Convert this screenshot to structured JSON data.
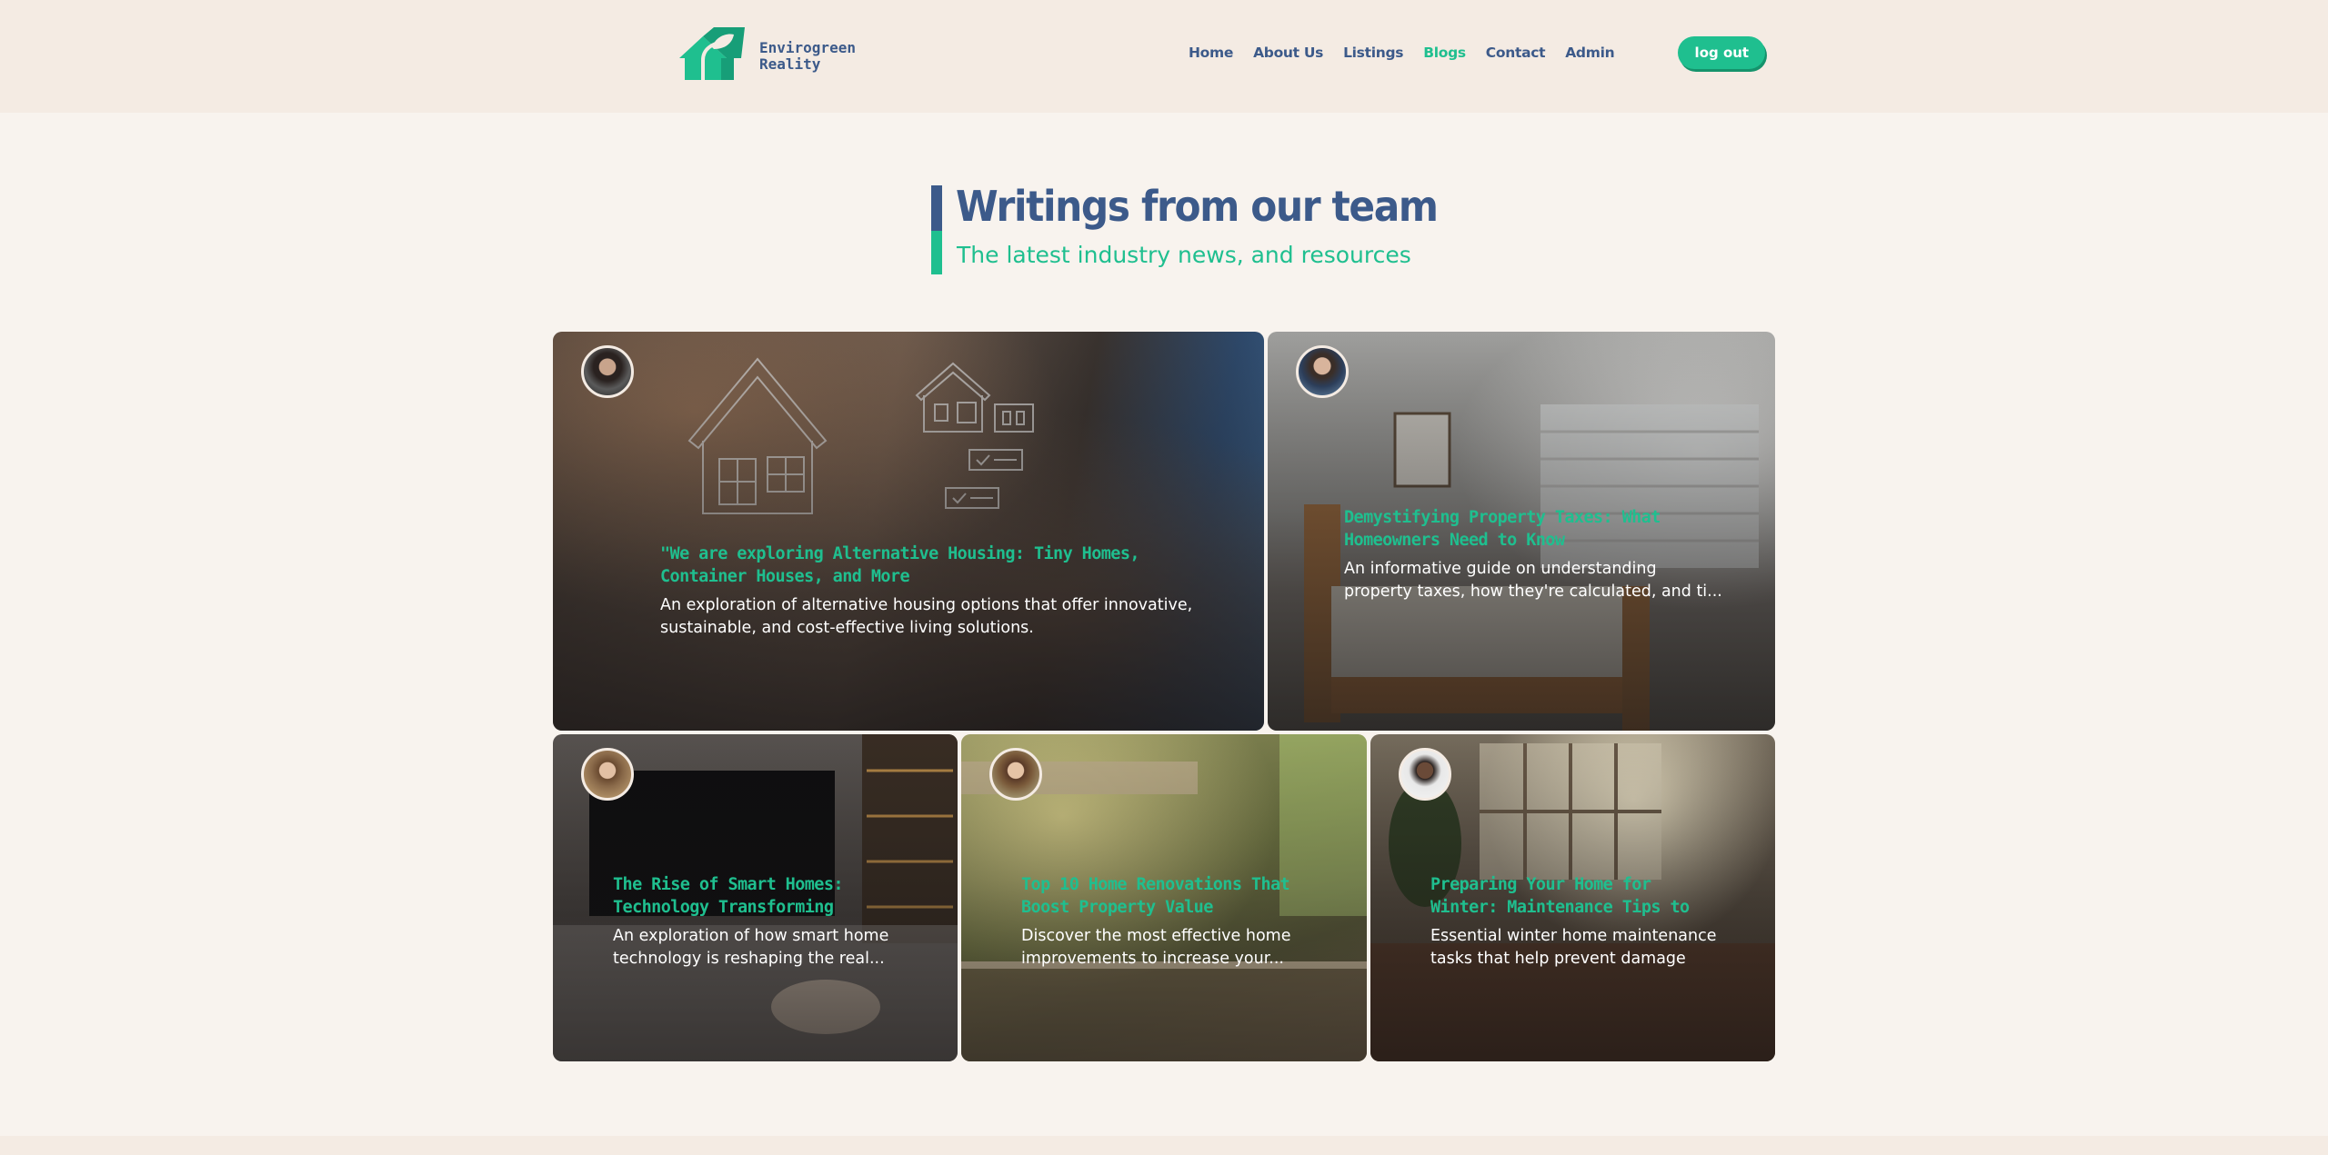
{
  "brand": {
    "name_line1": "Envirogreen",
    "name_line2": "Reality"
  },
  "nav": {
    "items": [
      {
        "label": "Home",
        "active": false
      },
      {
        "label": "About Us",
        "active": false
      },
      {
        "label": "Listings",
        "active": false
      },
      {
        "label": "Blogs",
        "active": true
      },
      {
        "label": "Contact",
        "active": false
      },
      {
        "label": "Admin",
        "active": false
      }
    ],
    "logout_label": "log out"
  },
  "section": {
    "title": "Writings from our team",
    "subtitle": "The latest industry news, and resources"
  },
  "posts": [
    {
      "title": "\"We are exploring Alternative Housing: Tiny Homes, Container Houses, and More",
      "description": "An exploration of alternative housing options that offer innovative, sustainable, and cost-effective living solutions."
    },
    {
      "title": "Demystifying Property Taxes: What Homeowners Need to Know",
      "description": "An informative guide on understanding property taxes, how they're calculated, and ti..."
    },
    {
      "title": "The Rise of Smart Homes: Technology Transforming Real...",
      "description": "An exploration of how smart home technology is reshaping the real..."
    },
    {
      "title": "Top 10 Home Renovations That Boost Property Value",
      "description": "Discover the most effective home improvements to increase your..."
    },
    {
      "title": "Preparing Your Home for Winter: Maintenance Tips to Protect Yo...",
      "description": "Essential winter home maintenance tasks that help prevent damage and..."
    }
  ],
  "colors": {
    "brand_blue": "#3c5a8a",
    "brand_green": "#1fbf8f",
    "page_bg": "#f8f3ee"
  }
}
